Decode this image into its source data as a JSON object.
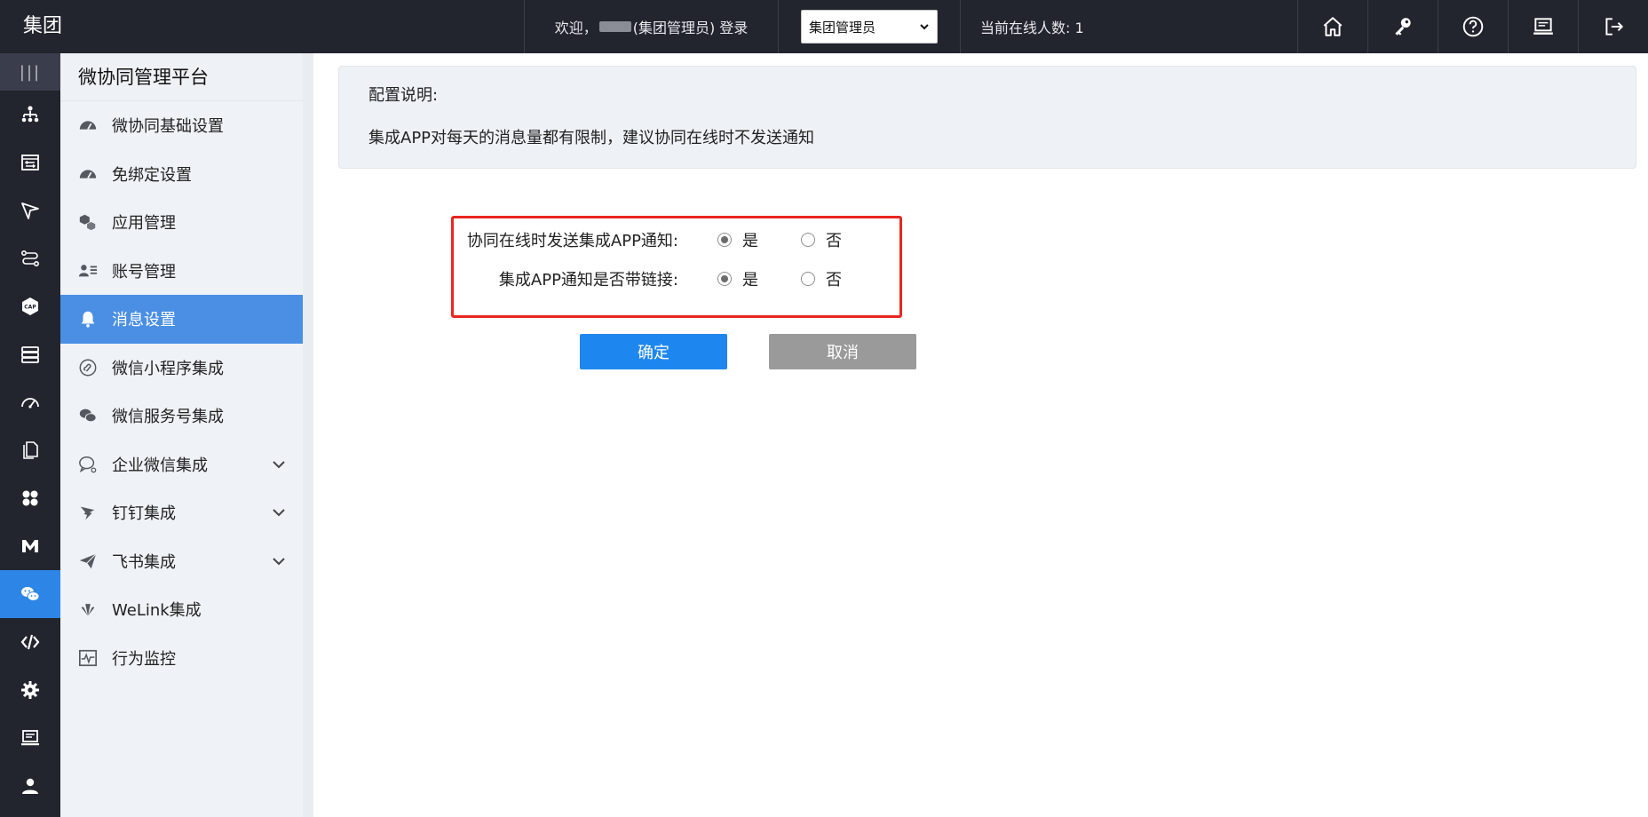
{
  "header": {
    "brand": "集团",
    "welcome_prefix": "欢迎，",
    "welcome_suffix": "(集团管理员) 登录",
    "role_selected": "集团管理员",
    "online_text": "当前在线人数: 1",
    "icons": [
      "home-icon",
      "key-icon",
      "help-icon",
      "monitor-icon",
      "logout-icon"
    ]
  },
  "rail": {
    "icons": [
      "org-tree-icon",
      "form-icon",
      "send-icon",
      "flow-icon",
      "cap-icon",
      "database-icon",
      "dashboard-icon",
      "document-icon",
      "apps-icon",
      "m-icon",
      "wechat-icon",
      "code-icon",
      "settings-icon",
      "screen-icon",
      "user-icon"
    ],
    "active_index": 10
  },
  "sidebar": {
    "title": "微协同管理平台",
    "items": [
      {
        "label": "微协同基础设置",
        "icon": "speedometer-icon"
      },
      {
        "label": "免绑定设置",
        "icon": "speedometer-icon"
      },
      {
        "label": "应用管理",
        "icon": "app-cubes-icon"
      },
      {
        "label": "账号管理",
        "icon": "account-card-icon"
      },
      {
        "label": "消息设置",
        "icon": "bell-icon"
      },
      {
        "label": "微信小程序集成",
        "icon": "miniprogram-icon"
      },
      {
        "label": "微信服务号集成",
        "icon": "wechat-icon"
      },
      {
        "label": "企业微信集成",
        "icon": "wecom-icon"
      },
      {
        "label": "钉钉集成",
        "icon": "dingtalk-icon"
      },
      {
        "label": "飞书集成",
        "icon": "feishu-icon"
      },
      {
        "label": "WeLink集成",
        "icon": "welink-icon"
      },
      {
        "label": "行为监控",
        "icon": "monitor-chart-icon"
      }
    ],
    "active_index": 4
  },
  "note": {
    "title": "配置说明:",
    "text": "集成APP对每天的消息量都有限制，建议协同在线时不发送通知"
  },
  "form": {
    "rows": [
      {
        "label": "协同在线时发送集成APP通知:",
        "yes": "是",
        "no": "否",
        "selected": "是"
      },
      {
        "label": "集成APP通知是否带链接:",
        "yes": "是",
        "no": "否",
        "selected": "是"
      }
    ],
    "ok_label": "确定",
    "cancel_label": "取消"
  },
  "colors": {
    "topbar": "#22242e",
    "accent": "#2d86e6",
    "highlight_border": "#e8261f",
    "cancel": "#9a9a9a"
  }
}
